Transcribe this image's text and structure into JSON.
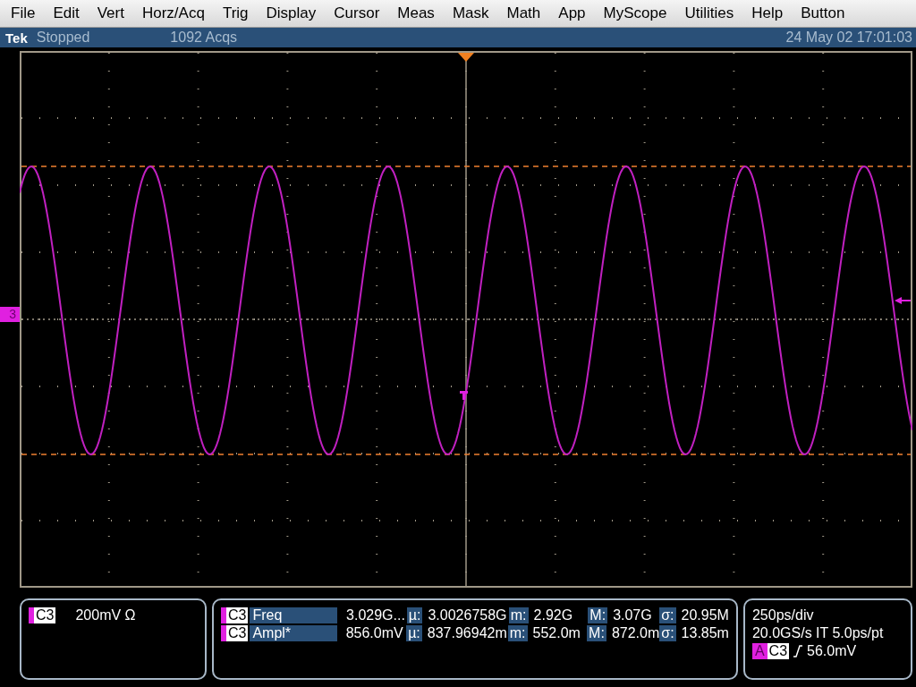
{
  "menu": [
    "File",
    "Edit",
    "Vert",
    "Horz/Acq",
    "Trig",
    "Display",
    "Cursor",
    "Meas",
    "Mask",
    "Math",
    "App",
    "MyScope",
    "Utilities",
    "Help",
    "Button"
  ],
  "status_bar": {
    "brand": "Tek",
    "state": "Stopped",
    "acquisitions": "1092 Acqs",
    "datetime": "24 May 02 17:01:03"
  },
  "channel_marker": "3",
  "channel_box": {
    "channel": "C3",
    "scale": "200mV Ω"
  },
  "measurements": [
    {
      "channel": "C3",
      "name": "Freq",
      "value": "3.029G...",
      "stats": [
        {
          "label": "µ:",
          "value": "3.0026758G"
        },
        {
          "label": "m:",
          "value": "2.92G"
        },
        {
          "label": "M:",
          "value": "3.07G"
        },
        {
          "label": "σ:",
          "value": "20.95M"
        }
      ]
    },
    {
      "channel": "C3",
      "name": "Ampl*",
      "value": "856.0mV",
      "stats": [
        {
          "label": "µ:",
          "value": "837.96942m"
        },
        {
          "label": "m:",
          "value": "552.0m"
        },
        {
          "label": "M:",
          "value": "872.0m"
        },
        {
          "label": "σ:",
          "value": "13.85m"
        }
      ]
    }
  ],
  "timebase": {
    "lines": [
      "250ps/div",
      "20.0GS/s IT 5.0ps/pt"
    ],
    "trigger": {
      "source_tag": "A",
      "channel": "C3",
      "level": "56.0mV"
    }
  }
}
